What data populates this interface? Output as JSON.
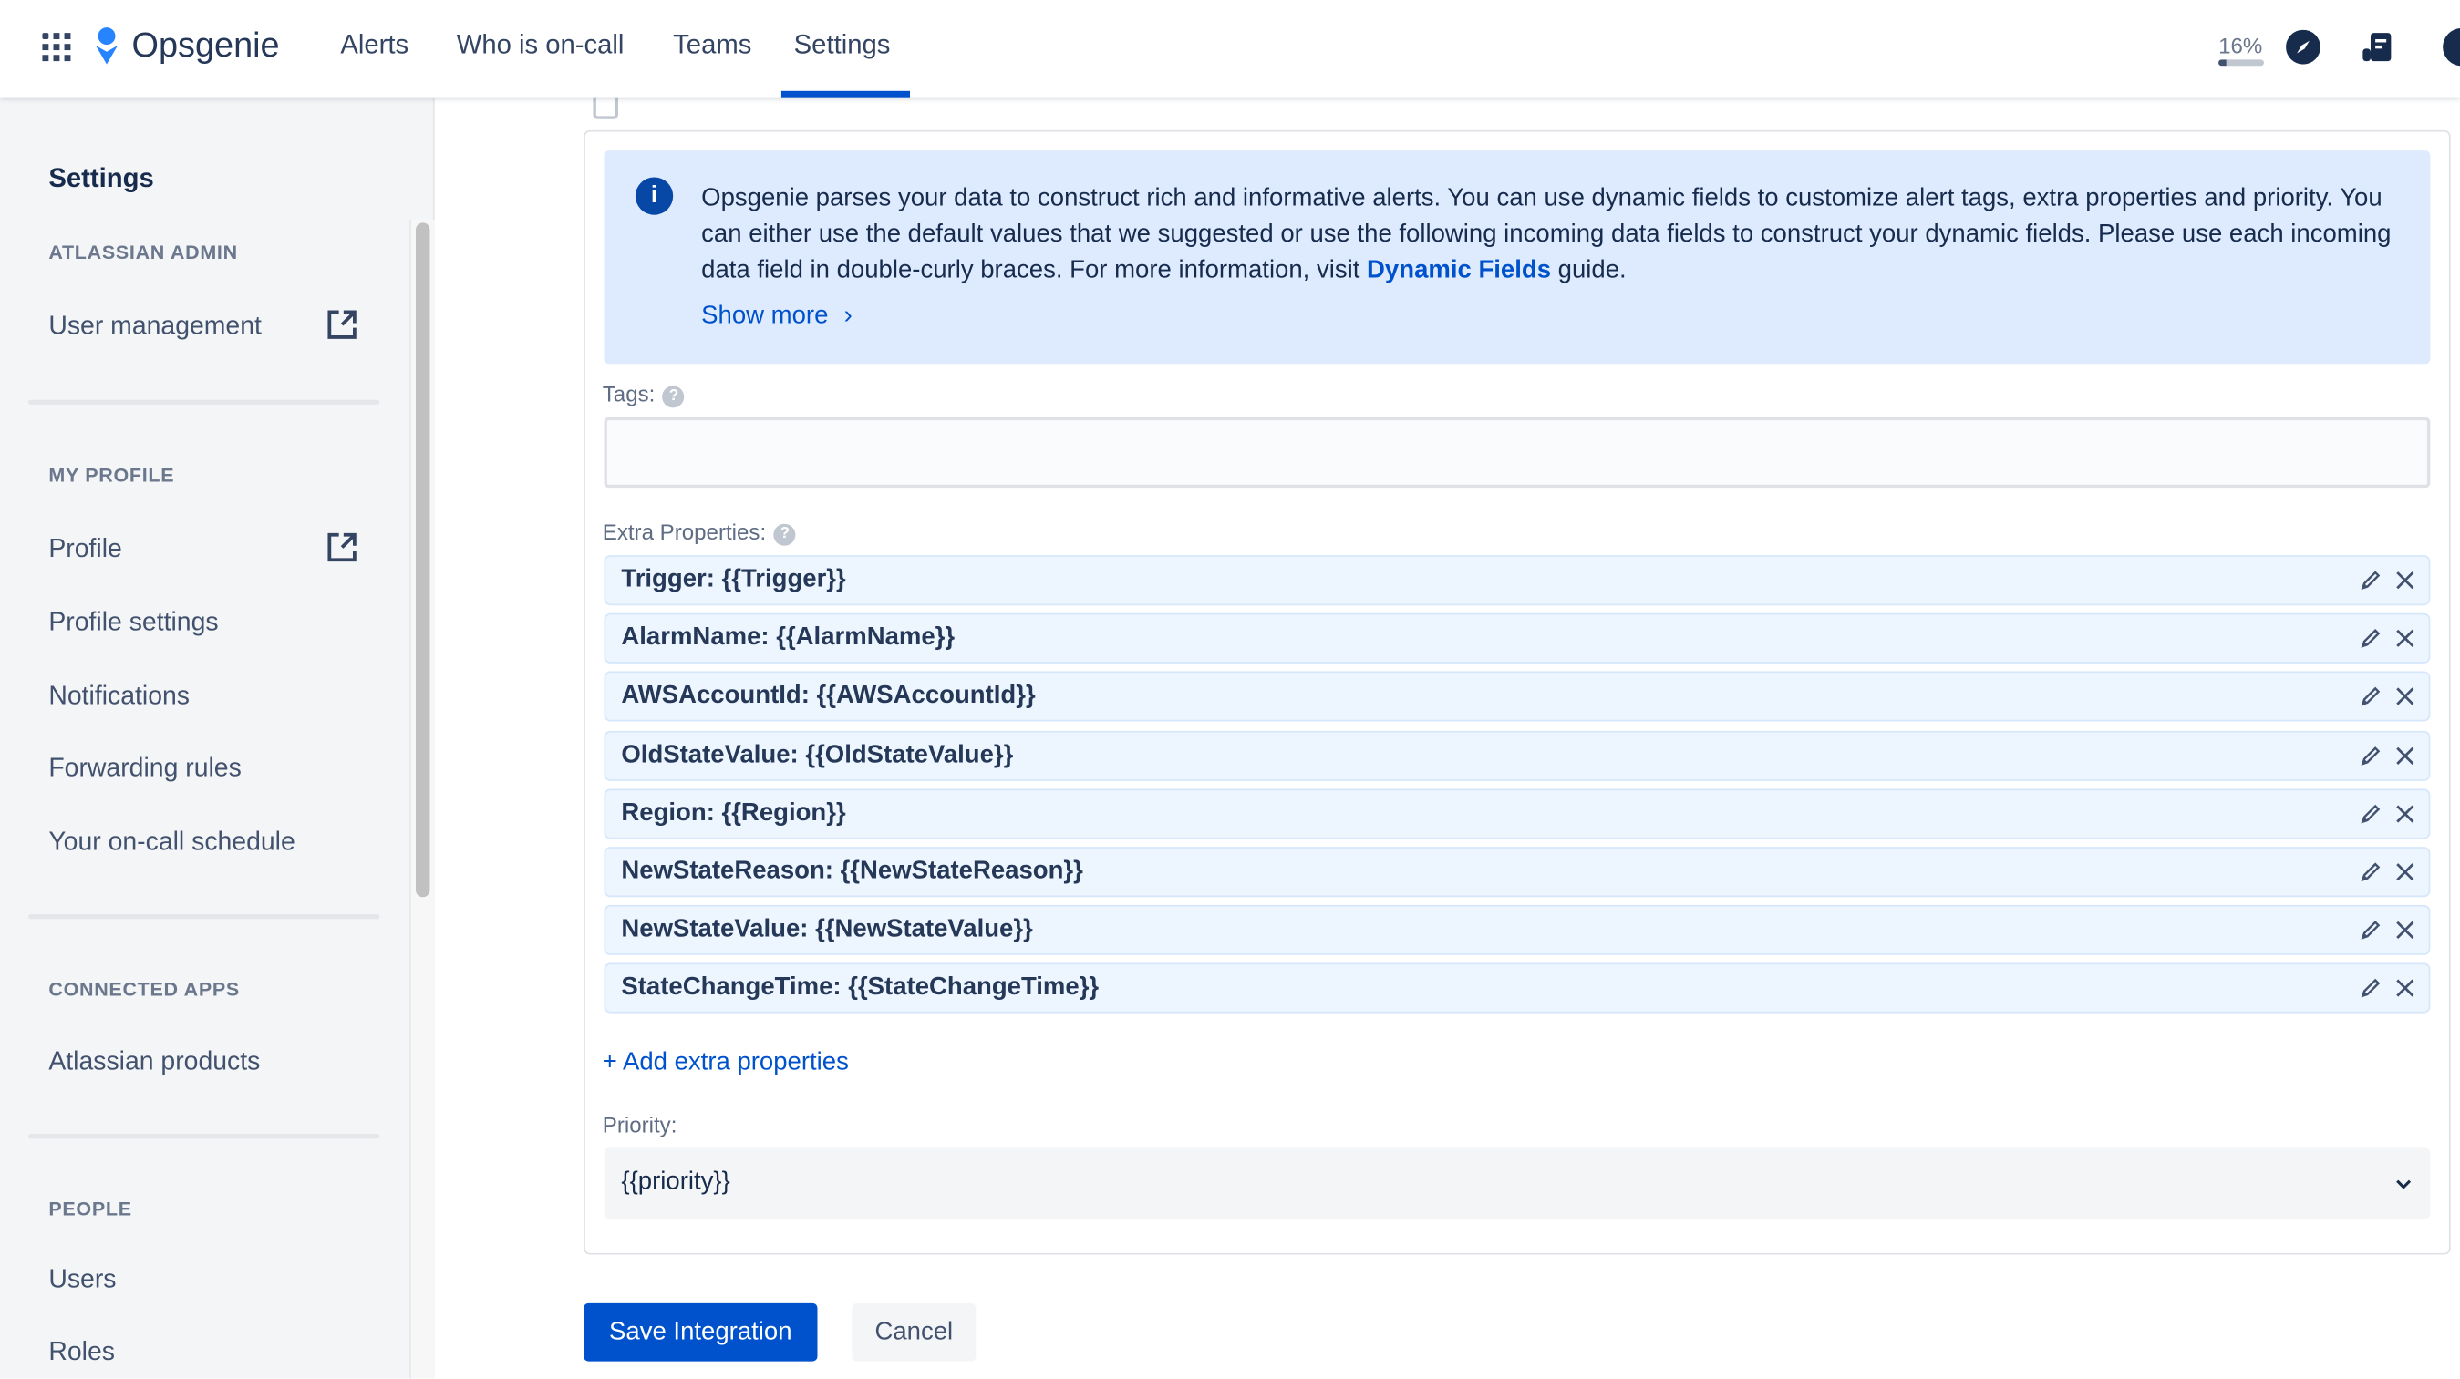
{
  "header": {
    "app_name": "Opsgenie",
    "nav": [
      "Alerts",
      "Who is on-call",
      "Teams",
      "Settings"
    ],
    "active_nav": "Settings",
    "progress_text": "16%",
    "progress": 0.16,
    "brand_color": "#0052cc"
  },
  "sidebar": {
    "title": "Settings",
    "sections": [
      {
        "header": "ATLASSIAN ADMIN",
        "items": [
          "User management"
        ]
      },
      {
        "header": "MY PROFILE",
        "items": [
          "Profile",
          "Profile settings",
          "Notifications",
          "Forwarding rules",
          "Your on-call schedule"
        ]
      },
      {
        "header": "CONNECTED APPS",
        "items": [
          "Atlassian products"
        ]
      },
      {
        "header": "PEOPLE",
        "items": [
          "Users",
          "Roles"
        ]
      }
    ]
  },
  "info": {
    "text": "Opsgenie parses your data to construct rich and informative alerts. You can use dynamic fields to customize alert tags, extra properties and priority. You can either use the default values that we suggested or use the following incoming data fields to construct your dynamic fields. Please use each incoming data field in double-curly braces. For more information, visit ",
    "link": "Dynamic Fields",
    "suffix": " guide.",
    "show_more": "Show more"
  },
  "form": {
    "tags_label": "Tags:",
    "tags_value": "",
    "extra_label": "Extra Properties:",
    "extra_properties": [
      "Trigger: {{Trigger}}",
      "AlarmName: {{AlarmName}}",
      "AWSAccountId: {{AWSAccountId}}",
      "OldStateValue: {{OldStateValue}}",
      "Region: {{Region}}",
      "NewStateReason: {{NewStateReason}}",
      "NewStateValue: {{NewStateValue}}",
      "StateChangeTime: {{StateChangeTime}}"
    ],
    "add_extra": "+ Add extra properties",
    "priority_label": "Priority:",
    "priority_value": "{{priority}}"
  },
  "actions": {
    "save": "Save Integration",
    "cancel": "Cancel"
  }
}
